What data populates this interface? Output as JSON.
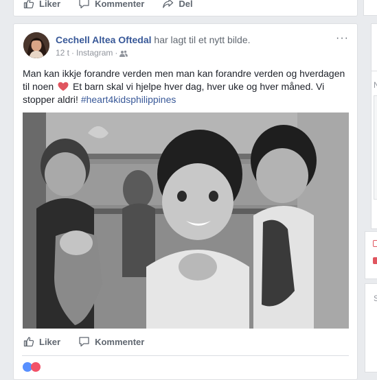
{
  "previous_post": {
    "like_label": "Liker",
    "comment_label": "Kommenter",
    "share_label": "Del"
  },
  "post": {
    "author": "Cechell Altea Oftedal",
    "action": "har lagt til et nytt bilde.",
    "time": "12 t",
    "source": "Instagram",
    "separator": "·",
    "text_before_heart": "Man kan ikkje forandre verden men man kan forandre verden og hverdagen til noen",
    "text_after_heart": "Et barn skal vi hjelpe hver dag, hver uke og hver måned. Vi stopper aldri!",
    "hashtag": "#heart4kidsphilippines",
    "more_label": "···",
    "like_label": "Liker",
    "comment_label": "Kommenter"
  },
  "right_column": {
    "letter_n": "N",
    "letter_s": "S"
  },
  "colors": {
    "link_blue": "#385898",
    "heart": "#e0555f",
    "background": "#e9ebee"
  },
  "icons": [
    "thumbs-up-icon",
    "comment-icon",
    "share-icon",
    "friends-icon",
    "heart-icon",
    "more-options-icon"
  ]
}
